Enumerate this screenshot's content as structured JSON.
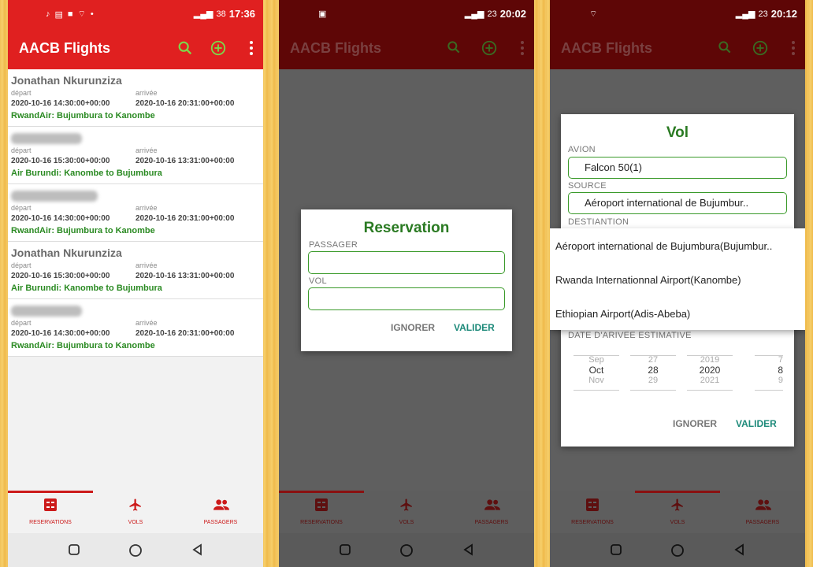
{
  "app_title": "AACB Flights",
  "status": {
    "time1": "17:36",
    "time2": "20:02",
    "time3": "20:12",
    "battery1": "38",
    "battery2": "23",
    "battery3": "23"
  },
  "reservations": [
    {
      "name": "Jonathan Nkurunziza",
      "blurred": false,
      "depart_label": "départ",
      "arrive_label": "arrivée",
      "depart": "2020-10-16 14:30:00+00:00",
      "arrive": "2020-10-16 20:31:00+00:00",
      "route": "RwandAir: Bujumbura to Kanombe"
    },
    {
      "name": "",
      "blurred": true,
      "depart_label": "départ",
      "arrive_label": "arrivée",
      "depart": "2020-10-16 15:30:00+00:00",
      "arrive": "2020-10-16 13:31:00+00:00",
      "route": "Air Burundi: Kanombe to Bujumbura"
    },
    {
      "name": "",
      "blurred": true,
      "depart_label": "départ",
      "arrive_label": "arrivée",
      "depart": "2020-10-16 14:30:00+00:00",
      "arrive": "2020-10-16 20:31:00+00:00",
      "route": "RwandAir: Bujumbura to Kanombe"
    },
    {
      "name": "Jonathan Nkurunziza",
      "blurred": false,
      "depart_label": "départ",
      "arrive_label": "arrivée",
      "depart": "2020-10-16 15:30:00+00:00",
      "arrive": "2020-10-16 13:31:00+00:00",
      "route": "Air Burundi: Kanombe to Bujumbura"
    },
    {
      "name": "",
      "blurred": true,
      "depart_label": "départ",
      "arrive_label": "arrivée",
      "depart": "2020-10-16 14:30:00+00:00",
      "arrive": "2020-10-16 20:31:00+00:00",
      "route": "RwandAir: Bujumbura to Kanombe"
    }
  ],
  "bottom_nav": {
    "reservations": "RESERVATIONS",
    "vols": "VOLS",
    "passagers": "PASSAGERS"
  },
  "reservation_dialog": {
    "title": "Reservation",
    "passager_label": "PASSAGER",
    "passager_value": "",
    "vol_label": "VOL",
    "vol_value": "",
    "cancel": "IGNORER",
    "confirm": "VALIDER"
  },
  "vol_dialog": {
    "title": "Vol",
    "avion_label": "AVION",
    "avion_value": "Falcon 50(1)",
    "source_label": "SOURCE",
    "source_value": "Aéroport international de Bujumbur..",
    "destination_label": "DESTIANTION",
    "dropdown_options": [
      "Aéroport international de Bujumbura(Bujumbur..",
      "Rwanda Internationnal Airport(Kanombe)",
      "Ethiopian Airport(Adis-Abeba)"
    ],
    "arrival_label": "DATE D'ARIVEE ESTIMATIVE",
    "picker": {
      "month": [
        "Sep",
        "Oct",
        "Nov"
      ],
      "day": [
        "27",
        "28",
        "29"
      ],
      "year": [
        "2019",
        "2020",
        "2021"
      ],
      "hour": [
        "7",
        "8",
        "9"
      ]
    },
    "cancel": "IGNORER",
    "confirm": "VALIDER"
  },
  "colors": {
    "primary": "#e02020",
    "accent_green": "#2a8a22",
    "action_green": "#7cd84a",
    "teal_button": "#1d8a7a"
  },
  "icons": [
    "search-icon",
    "add-circle-icon",
    "more-vert-icon",
    "reservations-icon",
    "airplane-icon",
    "people-icon"
  ]
}
